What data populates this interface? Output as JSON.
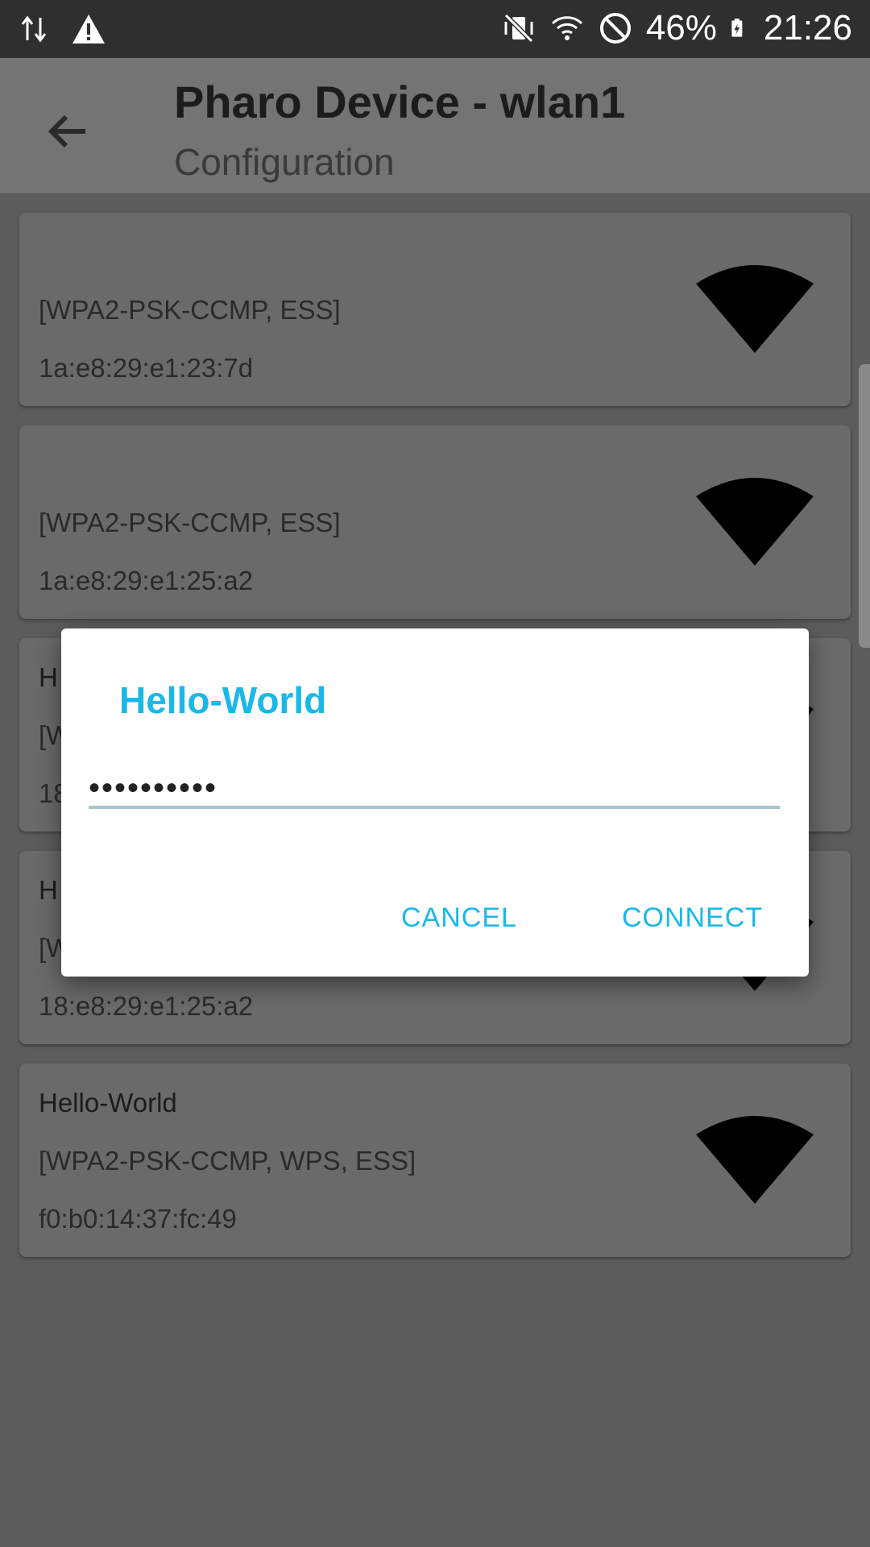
{
  "status_bar": {
    "battery": "46%",
    "time": "21:26",
    "icons": [
      "data-transfer-icon",
      "warning-icon",
      "vibrate-mute-icon",
      "wifi-icon",
      "do-not-disturb-icon",
      "battery-charging-icon"
    ]
  },
  "app_bar": {
    "title": "Pharo Device - wlan1",
    "subtitle": "Configuration",
    "back_icon": "arrow-back-icon"
  },
  "networks": [
    {
      "ssid": "",
      "capabilities": "[WPA2-PSK-CCMP, ESS]",
      "bssid": "1a:e8:29:e1:23:7d",
      "signal_icon": "wifi-signal-icon"
    },
    {
      "ssid": "",
      "capabilities": "[WPA2-PSK-CCMP, ESS]",
      "bssid": "1a:e8:29:e1:25:a2",
      "signal_icon": "wifi-signal-icon"
    },
    {
      "ssid": "H",
      "capabilities": "[W",
      "bssid": "18",
      "signal_icon": "wifi-signal-icon"
    },
    {
      "ssid": "H",
      "capabilities": "[W",
      "bssid": "18:e8:29:e1:25:a2",
      "signal_icon": "wifi-signal-icon"
    },
    {
      "ssid": "Hello-World",
      "capabilities": "[WPA2-PSK-CCMP, WPS, ESS]",
      "bssid": "f0:b0:14:37:fc:49",
      "signal_icon": "wifi-signal-icon"
    }
  ],
  "dialog": {
    "title": "Hello-World",
    "password_value": "••••••••••",
    "cancel_label": "CANCEL",
    "connect_label": "CONNECT"
  },
  "colors": {
    "accent": "#1ab8e8",
    "scrim_background": "#5c5c5c",
    "card": "#6a6a6a",
    "status_bar": "#2f2f2f"
  }
}
